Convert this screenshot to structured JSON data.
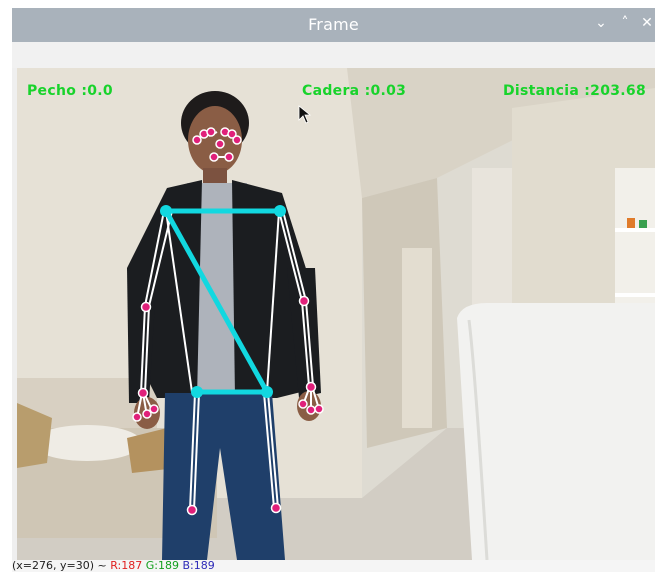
{
  "window": {
    "title": "Frame",
    "controls": {
      "minimize_icon": "chevron-down-icon",
      "maximize_icon": "chevron-up-icon",
      "close_icon": "close-icon"
    }
  },
  "overlay": {
    "pecho": "Pecho :0.0",
    "cadera": "Cadera :0.03",
    "distancia": "Distancia :203.68",
    "text_color": "#18d32b"
  },
  "pose": {
    "skeleton_color": "#ffffff",
    "joint_color": "#e0207a",
    "torso_color": "#12d8e0"
  },
  "status": {
    "coords": "(x=276, y=30) ~ ",
    "r": "R:187",
    "g": "G:189",
    "b": "B:189"
  }
}
